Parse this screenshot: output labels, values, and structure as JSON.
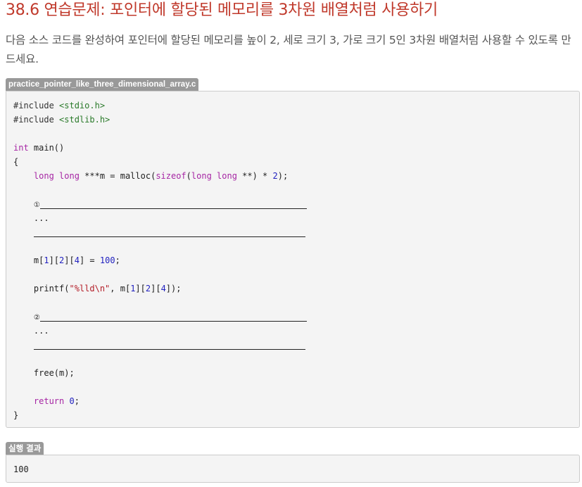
{
  "page": {
    "title": "38.6 연습문제: 포인터에 할당된 메모리를 3차원 배열처럼 사용하기",
    "description": "다음 소스 코드를 완성하여 포인터에 할당된 메모리를 높이 2, 세로 크기 3, 가로 크기 5인 3차원 배열처럼 사용할 수 있도록 만드세요."
  },
  "code_block": {
    "filename": "practice_pointer_like_three_dimensional_array.c",
    "lines": {
      "l1": "#include ",
      "l1_header": "<stdio.h>",
      "l2": "#include ",
      "l2_header": "<stdlib.h>",
      "l4_kw": "int",
      "l4_rest": " main()",
      "l5": "{",
      "l6_kw1": "long long",
      "l6_mid": " ***m = malloc(",
      "l6_kw2": "sizeof",
      "l6_paren": "(",
      "l6_kw3": "long long",
      "l6_tail": " **) * ",
      "l6_num": "2",
      "l6_end": ");",
      "mark1": "①",
      "ellipsis1": "...",
      "l13_a": "m[",
      "l13_n1": "1",
      "l13_b": "][",
      "l13_n2": "2",
      "l13_c": "][",
      "l13_n3": "4",
      "l13_d": "] = ",
      "l13_n4": "100",
      "l13_e": ";",
      "l15_a": "printf(",
      "l15_str": "\"%lld\\n\"",
      "l15_b": ", m[",
      "l15_n1": "1",
      "l15_c": "][",
      "l15_n2": "2",
      "l15_d": "][",
      "l15_n3": "4",
      "l15_e": "]);",
      "mark2": "②",
      "ellipsis2": "...",
      "l21": "free(m);",
      "l23_kw": "return",
      "l23_sp": " ",
      "l23_num": "0",
      "l23_end": ";",
      "l24": "}"
    }
  },
  "result_block": {
    "label": "실행 결과",
    "output": "100"
  }
}
